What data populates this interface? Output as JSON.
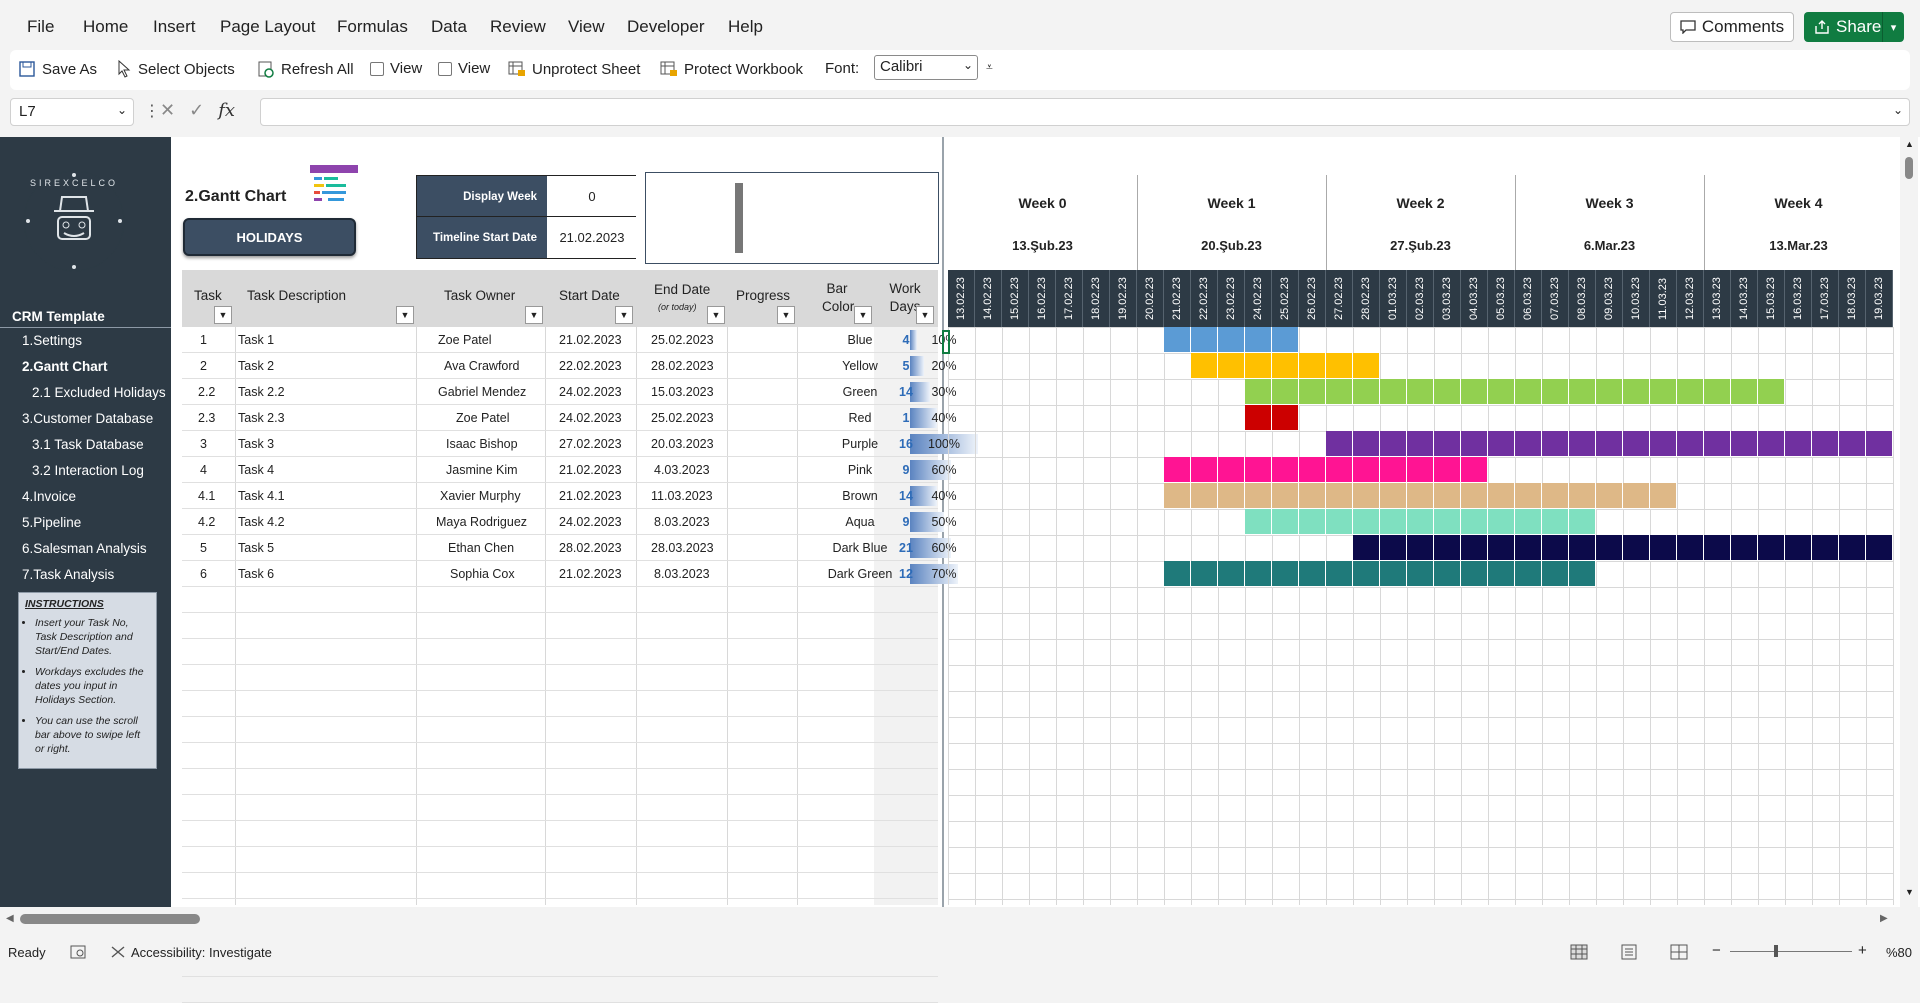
{
  "menu": [
    "File",
    "Home",
    "Insert",
    "Page Layout",
    "Formulas",
    "Data",
    "Review",
    "View",
    "Developer",
    "Help"
  ],
  "top_buttons": {
    "comments": "Comments",
    "share": "Share"
  },
  "ribbon": {
    "save_as": "Save As",
    "select_objects": "Select Objects",
    "refresh_all": "Refresh All",
    "view1": "View",
    "view2": "View",
    "unprotect": "Unprotect Sheet",
    "protect": "Protect Workbook",
    "font_label": "Font:",
    "font_value": "Calibri"
  },
  "formula_bar": {
    "name_box": "L7",
    "formula": ""
  },
  "sidebar": {
    "logo_text": "SIREXCELCO",
    "title": "CRM Template",
    "items": [
      {
        "label": "1.Settings",
        "sub": false,
        "active": false
      },
      {
        "label": "2.Gantt Chart",
        "sub": false,
        "active": true
      },
      {
        "label": "2.1 Excluded Holidays",
        "sub": true,
        "active": false
      },
      {
        "label": "3.Customer Database",
        "sub": false,
        "active": false
      },
      {
        "label": "3.1 Task Database",
        "sub": true,
        "active": false
      },
      {
        "label": "3.2 Interaction Log",
        "sub": true,
        "active": false
      },
      {
        "label": "4.Invoice",
        "sub": false,
        "active": false
      },
      {
        "label": "5.Pipeline",
        "sub": false,
        "active": false
      },
      {
        "label": "6.Salesman Analysis",
        "sub": false,
        "active": false
      },
      {
        "label": "7.Task Analysis",
        "sub": false,
        "active": false
      }
    ],
    "instructions_title": "INSTRUCTIONS",
    "instructions": [
      "Insert your Task No, Task Description and Start/End Dates.",
      "Workdays excludes the dates you input in Holidays Section.",
      "You can use the scroll bar above to swipe left or right."
    ]
  },
  "gantt": {
    "title": "2.Gantt Chart",
    "holidays_button": "HOLIDAYS",
    "display_week_label": "Display Week",
    "display_week_value": "0",
    "timeline_start_label": "Timeline Start Date",
    "timeline_start_value": "21.02.2023"
  },
  "table_headers": {
    "task": "Task",
    "desc": "Task Description",
    "owner": "Task Owner",
    "start": "Start Date",
    "end": "End Date",
    "end_sub": "(or today)",
    "progress": "Progress",
    "bar": "Bar Color",
    "work": "Work Days"
  },
  "tasks": [
    {
      "no": "1",
      "desc": "Task 1",
      "owner": "Zoe Patel",
      "start": "21.02.2023",
      "end": "25.02.2023",
      "progress": 10,
      "progress_label": "10%",
      "color_name": "Blue",
      "color": "#5b9bd5",
      "workdays": "4",
      "from": 8,
      "to": 13
    },
    {
      "no": "2",
      "desc": "Task 2",
      "owner": "Ava Crawford",
      "start": "22.02.2023",
      "end": "28.02.2023",
      "progress": 20,
      "progress_label": "20%",
      "color_name": "Yellow",
      "color": "#ffc000",
      "workdays": "5",
      "from": 9,
      "to": 16
    },
    {
      "no": "2.2",
      "desc": "Task 2.2",
      "owner": "Gabriel Mendez",
      "start": "24.02.2023",
      "end": "15.03.2023",
      "progress": 30,
      "progress_label": "30%",
      "color_name": "Green",
      "color": "#92d050",
      "workdays": "14",
      "from": 11,
      "to": 31
    },
    {
      "no": "2.3",
      "desc": "Task 2.3",
      "owner": "Zoe Patel",
      "start": "24.02.2023",
      "end": "25.02.2023",
      "progress": 40,
      "progress_label": "40%",
      "color_name": "Red",
      "color": "#cc0000",
      "workdays": "1",
      "from": 11,
      "to": 13
    },
    {
      "no": "3",
      "desc": "Task 3",
      "owner": "Isaac Bishop",
      "start": "27.02.2023",
      "end": "20.03.2023",
      "progress": 100,
      "progress_label": "100%",
      "color_name": "Purple",
      "color": "#7030a0",
      "workdays": "16",
      "from": 14,
      "to": 35
    },
    {
      "no": "4",
      "desc": "Task 4",
      "owner": "Jasmine Kim",
      "start": "21.02.2023",
      "end": "4.03.2023",
      "progress": 60,
      "progress_label": "60%",
      "color_name": "Pink",
      "color": "#ff1493",
      "workdays": "9",
      "from": 8,
      "to": 20
    },
    {
      "no": "4.1",
      "desc": "Task 4.1",
      "owner": "Xavier Murphy",
      "start": "21.02.2023",
      "end": "11.03.2023",
      "progress": 40,
      "progress_label": "40%",
      "color_name": "Brown",
      "color": "#deb887",
      "workdays": "14",
      "from": 8,
      "to": 27
    },
    {
      "no": "4.2",
      "desc": "Task 4.2",
      "owner": "Maya Rodriguez",
      "start": "24.02.2023",
      "end": "8.03.2023",
      "progress": 50,
      "progress_label": "50%",
      "color_name": "Aqua",
      "color": "#7fe0c0",
      "workdays": "9",
      "from": 11,
      "to": 24
    },
    {
      "no": "5",
      "desc": "Task 5",
      "owner": "Ethan Chen",
      "start": "28.02.2023",
      "end": "28.03.2023",
      "progress": 60,
      "progress_label": "60%",
      "color_name": "Dark Blue",
      "color": "#0c0a4a",
      "workdays": "21",
      "from": 15,
      "to": 35
    },
    {
      "no": "6",
      "desc": "Task 6",
      "owner": "Sophia Cox",
      "start": "21.02.2023",
      "end": "8.03.2023",
      "progress": 70,
      "progress_label": "70%",
      "color_name": "Dark Green",
      "color": "#1f7a7a",
      "workdays": "12",
      "from": 8,
      "to": 24
    }
  ],
  "weeks": [
    {
      "label": "Week 0",
      "date": "13.Şub.23"
    },
    {
      "label": "Week 1",
      "date": "20.Şub.23"
    },
    {
      "label": "Week 2",
      "date": "27.Şub.23"
    },
    {
      "label": "Week 3",
      "date": "6.Mar.23"
    },
    {
      "label": "Week 4",
      "date": "13.Mar.23"
    }
  ],
  "days": [
    "13.02.23",
    "14.02.23",
    "15.02.23",
    "16.02.23",
    "17.02.23",
    "18.02.23",
    "19.02.23",
    "20.02.23",
    "21.02.23",
    "22.02.23",
    "23.02.23",
    "24.02.23",
    "25.02.23",
    "26.02.23",
    "27.02.23",
    "28.02.23",
    "01.03.23",
    "02.03.23",
    "03.03.23",
    "04.03.23",
    "05.03.23",
    "06.03.23",
    "07.03.23",
    "08.03.23",
    "09.03.23",
    "10.03.23",
    "11.03.23",
    "12.03.23",
    "13.03.23",
    "14.03.23",
    "15.03.23",
    "16.03.23",
    "17.03.23",
    "18.03.23",
    "19.03.23"
  ],
  "status": {
    "ready": "Ready",
    "accessibility": "Accessibility: Investigate",
    "zoom": "%80"
  }
}
